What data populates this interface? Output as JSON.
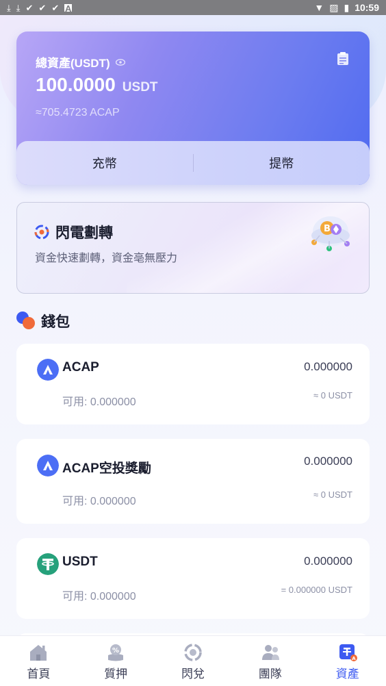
{
  "status_bar": {
    "time": "10:59"
  },
  "asset_card": {
    "title": "總資產(USDT)",
    "amount": "100.0000",
    "unit": "USDT",
    "approx": "≈705.4723 ACAP",
    "deposit_label": "充幣",
    "withdraw_label": "提幣"
  },
  "flash_transfer": {
    "title": "閃電劃轉",
    "subtitle": "資金快速劃轉，資金亳無壓力"
  },
  "wallet": {
    "title": "錢包",
    "items": [
      {
        "name": "ACAP",
        "balance": "0.000000",
        "available": "可用: 0.000000",
        "usdt": "≈ 0 USDT",
        "icon": "acap-logo-icon"
      },
      {
        "name": "ACAP空投獎勵",
        "balance": "0.000000",
        "available": "可用: 0.000000",
        "usdt": "≈ 0 USDT",
        "icon": "acap-logo-icon"
      },
      {
        "name": "USDT",
        "balance": "0.000000",
        "available": "可用: 0.000000",
        "usdt": "= 0.000000 USDT",
        "icon": "tether-logo-icon"
      }
    ]
  },
  "bottom_nav": {
    "items": [
      {
        "label": "首頁",
        "icon": "home-icon",
        "active": false
      },
      {
        "label": "質押",
        "icon": "stake-icon",
        "active": false
      },
      {
        "label": "閃兌",
        "icon": "exchange-icon",
        "active": false
      },
      {
        "label": "團隊",
        "icon": "team-icon",
        "active": false
      },
      {
        "label": "資產",
        "icon": "assets-icon",
        "active": true
      }
    ]
  },
  "colors": {
    "accent": "#3d5af1",
    "card_gradient_start": "#b7a6f6",
    "card_gradient_end": "#4f6af0",
    "acap_logo": "#4c6ef5",
    "tether_logo": "#26a17b"
  }
}
